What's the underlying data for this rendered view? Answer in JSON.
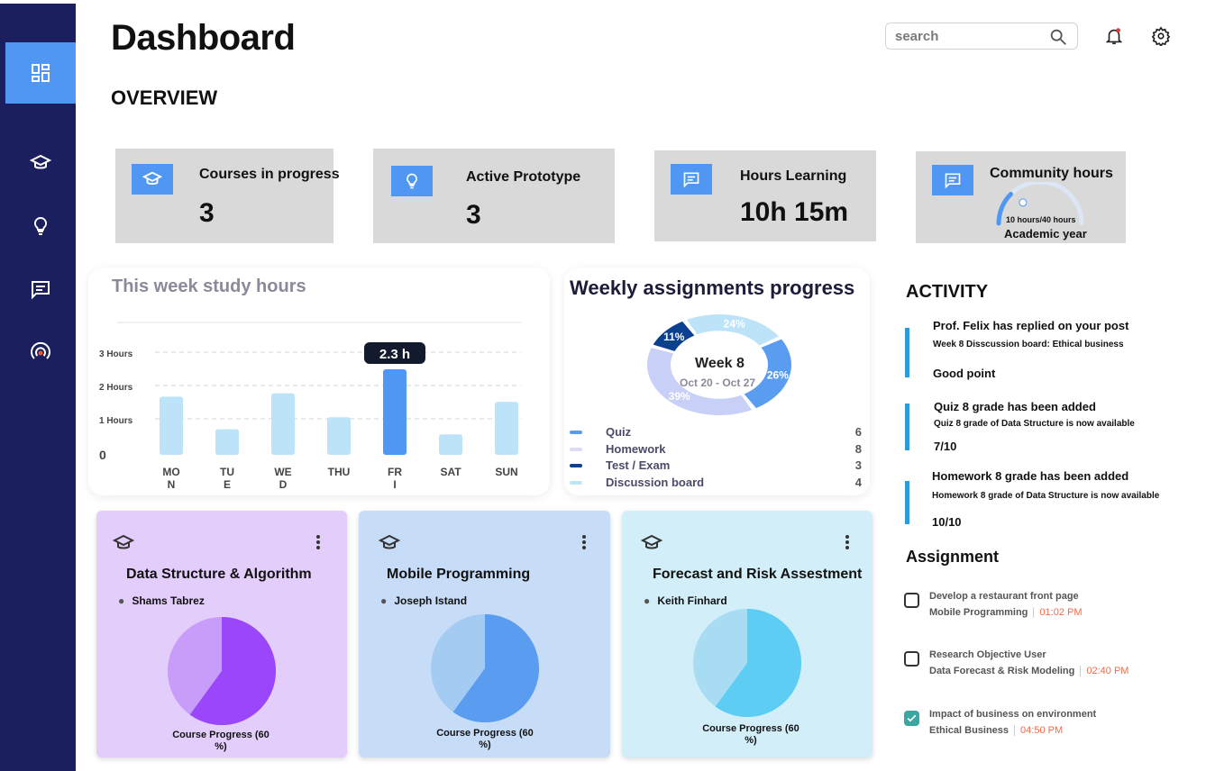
{
  "page": {
    "title": "Dashboard",
    "section": "OVERVIEW"
  },
  "search": {
    "placeholder": "search"
  },
  "sidebar": {
    "items": [
      {
        "icon": "dashboard-icon",
        "active": true
      },
      {
        "icon": "graduation-cap-icon"
      },
      {
        "icon": "lightbulb-icon"
      },
      {
        "icon": "message-icon"
      },
      {
        "icon": "broadcast-icon"
      }
    ]
  },
  "stats": [
    {
      "label": "Courses in progress",
      "value": "3",
      "icon": "graduation-cap-icon"
    },
    {
      "label": "Active Prototype",
      "value": "3",
      "icon": "lightbulb-icon"
    },
    {
      "label": "Hours Learning",
      "value": "10h 15m",
      "icon": "message-icon"
    },
    {
      "label": "Community hours",
      "gauge_text": "10 hours/40 hours",
      "sub": "Academic year",
      "progress": 0.25,
      "icon": "message-icon"
    }
  ],
  "colors": {
    "sidebar": "#1b1f5e",
    "accent": "#4f97f2",
    "bar": "#bde3f8",
    "bar_highlight": "#4f97f2"
  },
  "study_chart": {
    "title": "This week study hours",
    "highlight_label": "2.3 h",
    "chart_data": {
      "type": "bar",
      "categories": [
        "MO\nN",
        "TU\nE",
        "WE\nD",
        "THU",
        "FR\nI",
        "SAT",
        "SUN"
      ],
      "values": [
        1.7,
        0.75,
        1.8,
        1.1,
        2.5,
        0.6,
        1.55
      ],
      "ytick_labels": [
        "3 Hours",
        "2 Hours",
        "1 Hours",
        "0"
      ],
      "ylim": [
        0,
        3
      ],
      "highlight_index": 4
    }
  },
  "assignments_chart": {
    "title": "Weekly assignments progress",
    "center_title": "Week 8",
    "center_sub": "Oct 20 - Oct 27",
    "chart_data": {
      "type": "pie",
      "labels": [
        "11%",
        "24%",
        "26%",
        "39%"
      ],
      "values": [
        11,
        24,
        26,
        39
      ],
      "colors": [
        "#0b3f8f",
        "#bde3f8",
        "#5a9cf0",
        "#c9d0f7"
      ]
    },
    "legend": [
      {
        "name": "Quiz",
        "value": "6",
        "color": "#5a9cf0"
      },
      {
        "name": "Homework",
        "value": "8",
        "color": "#dcdcf5"
      },
      {
        "name": "Test / Exam",
        "value": "3",
        "color": "#0b3f8f"
      },
      {
        "name": "Discussion board",
        "value": "4",
        "color": "#bde3f8"
      }
    ]
  },
  "activity": {
    "title": "ACTIVITY",
    "items": [
      {
        "title": "Prof. Felix has replied on your post",
        "detail": "Week 8 Disscussion board: Ethical business",
        "extra": "Good point"
      },
      {
        "title": "Quiz 8 grade has been added",
        "detail": "Quiz 8 grade of Data Structure is now available",
        "extra": "7/10"
      },
      {
        "title": "Homework 8 grade has been added",
        "detail": "Homework 8 grade of Data Structure is now available",
        "extra": "10/10"
      }
    ]
  },
  "assignment": {
    "title": "Assignment",
    "items": [
      {
        "title": "Develop a restaurant front page",
        "course": "Mobile Programming",
        "time": "01:02 PM",
        "done": false
      },
      {
        "title": "Research Objective User",
        "course": "Data Forecast & Risk Modeling",
        "time": "02:40 PM",
        "done": false
      },
      {
        "title": "Impact of business on environment",
        "course": "Ethical Business",
        "time": "04:50 PM",
        "done": true
      }
    ]
  },
  "courses": [
    {
      "title": "Data Structure & Algorithm",
      "instructor": "Shams Tabrez",
      "progress_label": "Course Progress (60\n%)",
      "progress": 0.6,
      "bg": "#e3cdfb",
      "light": "#c89cf9",
      "dark": "#9a47fb"
    },
    {
      "title": "Mobile Programming",
      "instructor": "Joseph Istand",
      "progress_label": "Course Progress (60\n%)",
      "progress": 0.6,
      "bg": "#c6dcf7",
      "light": "#a4cbf2",
      "dark": "#5a9cf0"
    },
    {
      "title": "Forecast and Risk Assestment",
      "instructor": "Keith Finhard",
      "progress_label": "Course Progress (60\n%)",
      "progress": 0.6,
      "bg": "#d2eff9",
      "light": "#a8dcf3",
      "dark": "#5dcdf3"
    }
  ]
}
